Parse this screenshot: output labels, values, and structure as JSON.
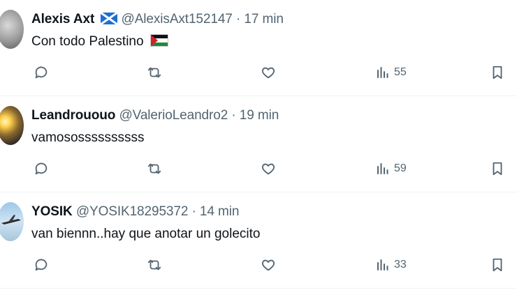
{
  "tweets": [
    {
      "name": "Alexis Axt",
      "handle": "@AlexisAxt152147",
      "time": "· 17 min",
      "text": "Con todo Palestino",
      "name_flag": "scotland-flag-icon",
      "text_flag": "palestine-flag-icon",
      "views": "55"
    },
    {
      "name": "Leandrououo",
      "handle": "@ValerioLeandro2",
      "time": "· 19 min",
      "text": "vamosossssssssss",
      "views": "59"
    },
    {
      "name": "YOSIK",
      "handle": "@YOSIK18295372",
      "time": "· 14 min",
      "text": "van biennn..hay que anotar un golecito",
      "views": "33"
    }
  ],
  "colors": {
    "text": "#0f1419",
    "secondary": "#536471",
    "divider": "#eff3f4"
  }
}
